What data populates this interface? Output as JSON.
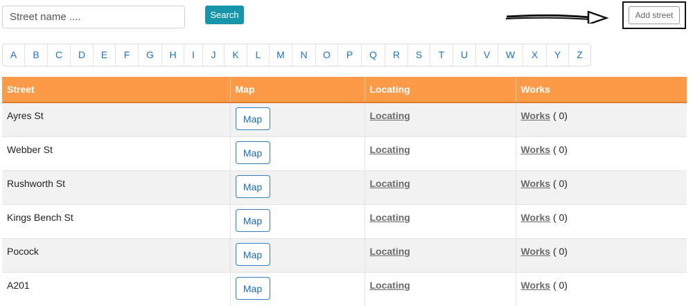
{
  "search": {
    "placeholder": "Street name ....",
    "button_label": "Search"
  },
  "add_street": {
    "label": "Add street"
  },
  "alphabet": [
    "A",
    "B",
    "C",
    "D",
    "E",
    "F",
    "G",
    "H",
    "I",
    "J",
    "K",
    "L",
    "M",
    "N",
    "O",
    "P",
    "Q",
    "R",
    "S",
    "T",
    "U",
    "V",
    "W",
    "X",
    "Y",
    "Z"
  ],
  "table": {
    "headers": [
      "Street",
      "Map",
      "Locating",
      "Works"
    ],
    "rows": [
      {
        "street": "Ayres St",
        "map": "Map",
        "locating": "Locating",
        "works": "Works",
        "count": "( 0)"
      },
      {
        "street": "Webber St",
        "map": "Map",
        "locating": "Locating",
        "works": "Works",
        "count": "( 0)"
      },
      {
        "street": "Rushworth St",
        "map": "Map",
        "locating": "Locating",
        "works": "Works",
        "count": "( 0)"
      },
      {
        "street": "Kings Bench St",
        "map": "Map",
        "locating": "Locating",
        "works": "Works",
        "count": "( 0)"
      },
      {
        "street": "Pocock",
        "map": "Map",
        "locating": "Locating",
        "works": "Works",
        "count": "( 0)"
      },
      {
        "street": "A201",
        "map": "Map",
        "locating": "Locating",
        "works": "Works",
        "count": "( 0)"
      }
    ]
  }
}
